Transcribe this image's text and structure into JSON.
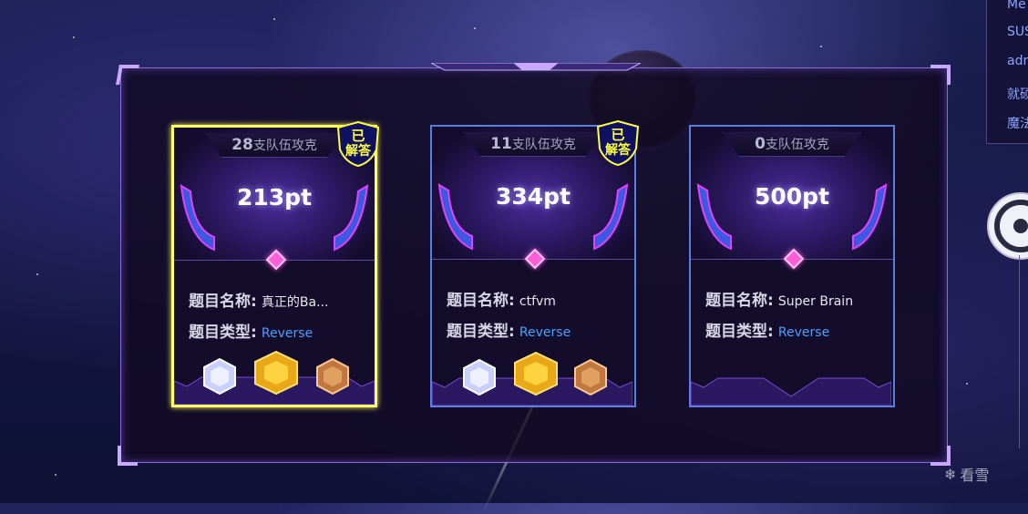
{
  "cards": [
    {
      "solved_count": "28",
      "solved_suffix": "支队伍攻克",
      "points": "213pt",
      "badge": {
        "line1": "已",
        "line2": "解答"
      },
      "name_label": "题目名称:",
      "name_value": "真正的Ba...",
      "type_label": "题目类型:",
      "type_value": "Reverse",
      "medals": [
        "silver-gem-icon",
        "gold-gem-icon",
        "bronze-gem-icon"
      ]
    },
    {
      "solved_count": "11",
      "solved_suffix": "支队伍攻克",
      "points": "334pt",
      "badge": {
        "line1": "已",
        "line2": "解答"
      },
      "name_label": "题目名称:",
      "name_value": "ctfvm",
      "type_label": "题目类型:",
      "type_value": "Reverse",
      "medals": [
        "silver-gem-icon",
        "gold-gem-icon",
        "bronze-gem-icon"
      ]
    },
    {
      "solved_count": "0",
      "solved_suffix": "支队伍攻克",
      "points": "500pt",
      "name_label": "题目名称:",
      "name_value": "Super Brain",
      "type_label": "题目类型:",
      "type_value": "Reverse",
      "medals": []
    }
  ],
  "side_list": [
    "Me",
    "SUS",
    "adr",
    "就硕",
    "魔法"
  ],
  "watermark": "看雪",
  "colors": {
    "solved_border": "#ffff66",
    "card_border": "#5a7fe0",
    "type_blue": "#4aa0ff",
    "badge_yellow": "#ffff44"
  }
}
